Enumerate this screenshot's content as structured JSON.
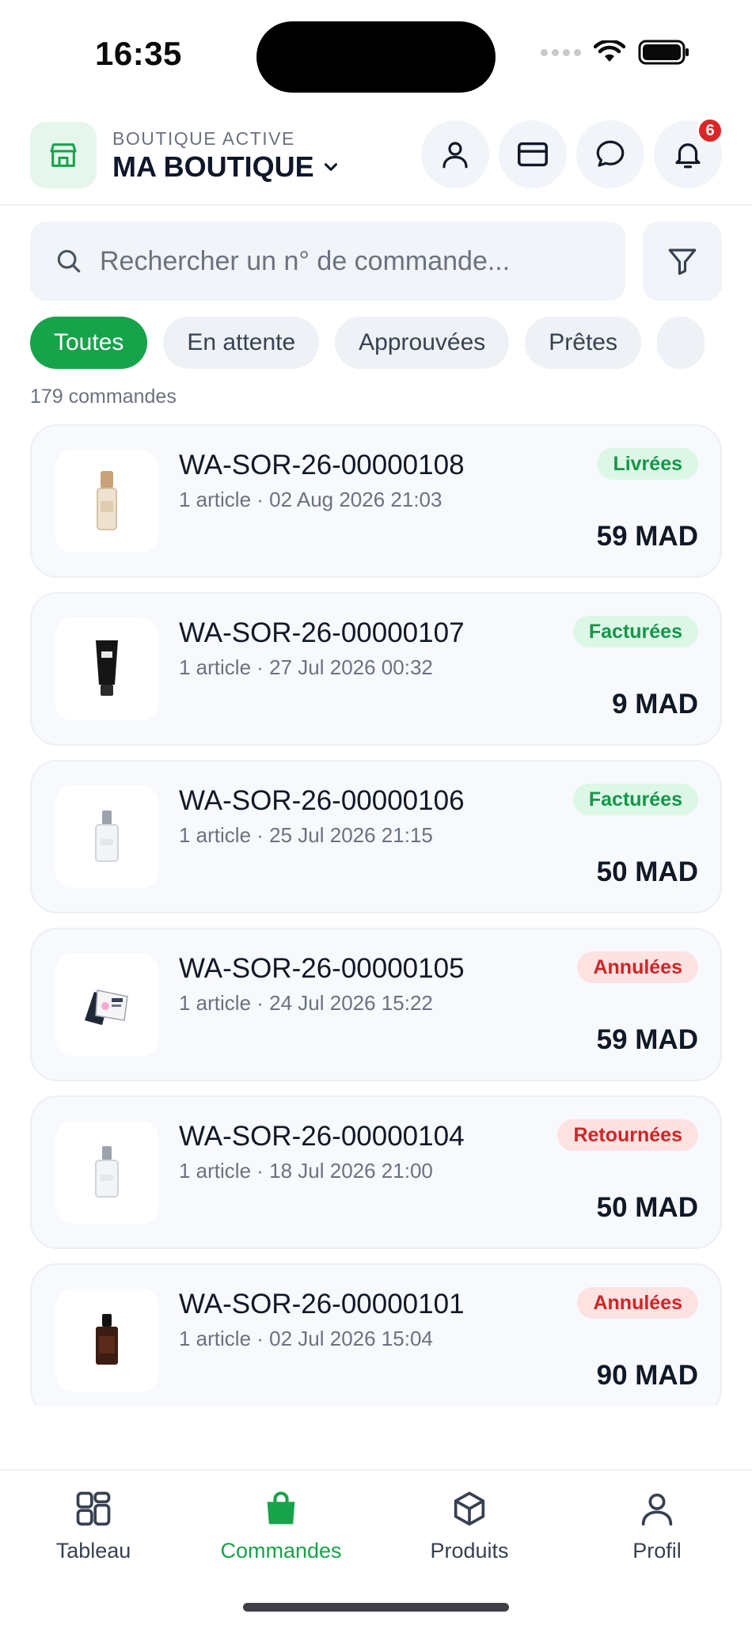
{
  "status_bar": {
    "time": "16:35"
  },
  "header": {
    "shop_label": "BOUTIQUE ACTIVE",
    "shop_name": "MA BOUTIQUE",
    "notification_count": "6",
    "icons": [
      "store-icon",
      "user-icon",
      "card-icon",
      "chat-icon",
      "bell-icon"
    ]
  },
  "search": {
    "placeholder": "Rechercher un n° de commande..."
  },
  "filters": {
    "chips": [
      "Toutes",
      "En attente",
      "Approuvées",
      "Prêtes"
    ],
    "active": "Toutes"
  },
  "orders_count": "179 commandes",
  "orders": [
    {
      "id": "WA-SOR-26-00000108",
      "meta": "1 article · 02 Aug 2026 21:03",
      "status": "Livrées",
      "status_color": "green",
      "total": "59 MAD",
      "thumb": "perfume-gold-icon"
    },
    {
      "id": "WA-SOR-26-00000107",
      "meta": "1 article · 27 Jul 2026 00:32",
      "status": "Facturées",
      "status_color": "green",
      "total": "9 MAD",
      "thumb": "cream-tube-icon"
    },
    {
      "id": "WA-SOR-26-00000106",
      "meta": "1 article · 25 Jul 2026 21:15",
      "status": "Facturées",
      "status_color": "green",
      "total": "50 MAD",
      "thumb": "perfume-clear-icon"
    },
    {
      "id": "WA-SOR-26-00000105",
      "meta": "1 article · 24 Jul 2026 15:22",
      "status": "Annulées",
      "status_color": "red",
      "total": "59 MAD",
      "thumb": "blush-palette-icon"
    },
    {
      "id": "WA-SOR-26-00000104",
      "meta": "1 article · 18 Jul 2026 21:00",
      "status": "Retournées",
      "status_color": "red",
      "total": "50 MAD",
      "thumb": "perfume-clear-icon"
    },
    {
      "id": "WA-SOR-26-00000101",
      "meta": "1 article · 02 Jul 2026 15:04",
      "status": "Annulées",
      "status_color": "red",
      "total": "90 MAD",
      "thumb": "perfume-dark-icon"
    }
  ],
  "nav": {
    "items": [
      "Tableau",
      "Commandes",
      "Produits",
      "Profil"
    ],
    "active": "Commandes"
  },
  "colors": {
    "accent": "#16a34a",
    "danger": "#dc2626",
    "muted": "#6b7280"
  }
}
